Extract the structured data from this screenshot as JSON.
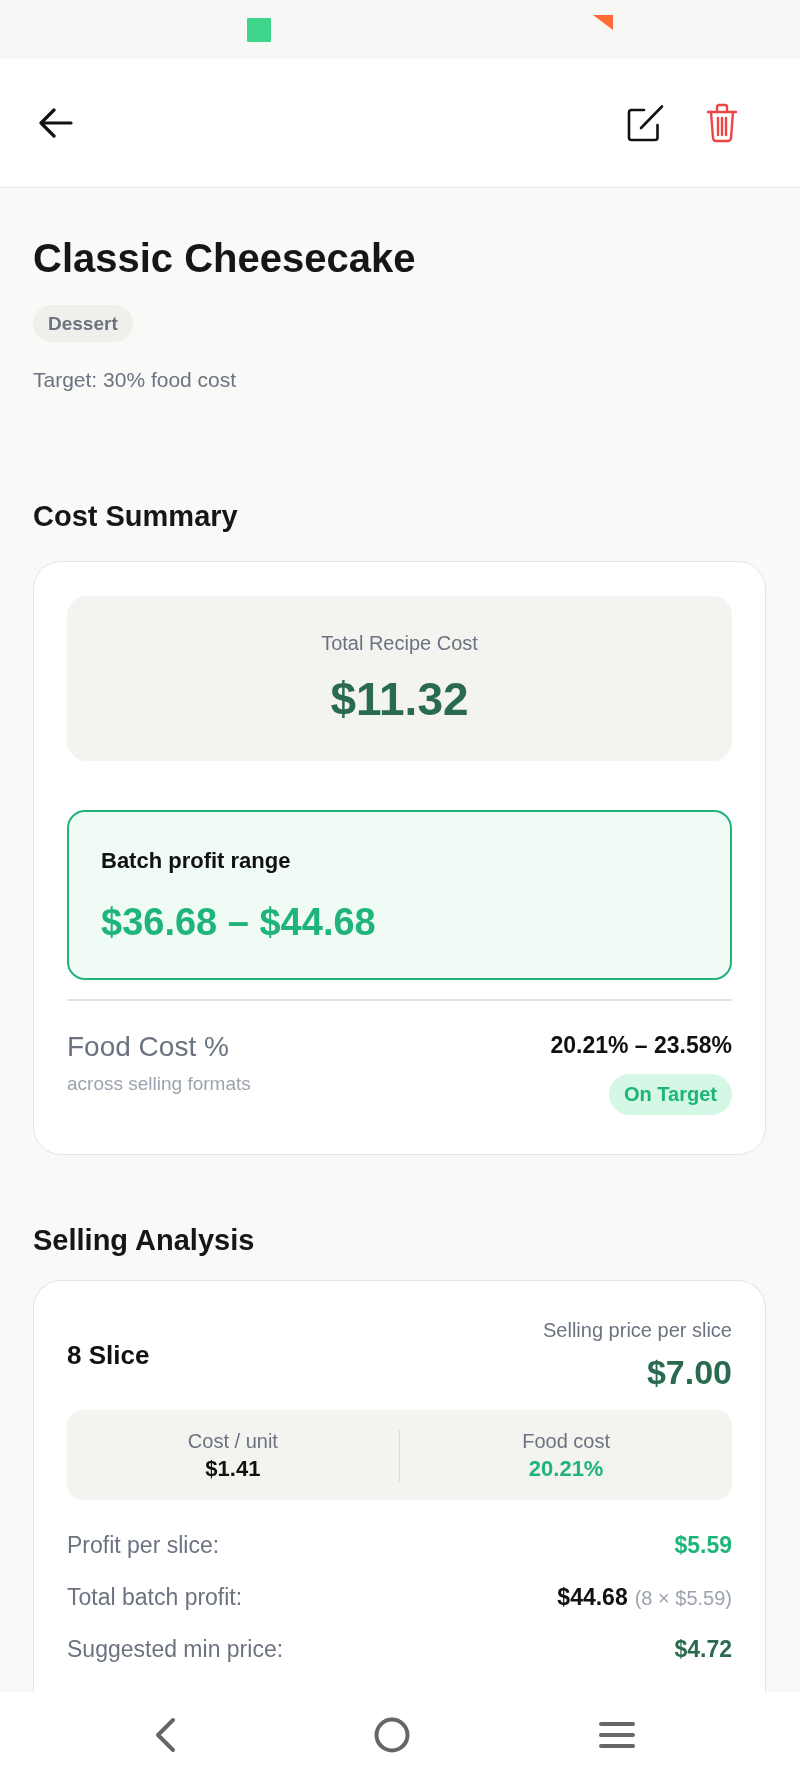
{
  "recipe": {
    "title": "Classic Cheesecake",
    "category": "Dessert",
    "target": "Target: 30% food cost"
  },
  "cost_summary": {
    "heading": "Cost Summary",
    "total": {
      "label": "Total Recipe Cost",
      "value": "$11.32"
    },
    "profit_range": {
      "label": "Batch profit range",
      "value": "$36.68 – $44.68"
    },
    "food_cost": {
      "label": "Food Cost %",
      "sublabel": "across selling formats",
      "value": "20.21% – 23.58%",
      "status": "On Target",
      "on_target": true
    }
  },
  "selling_analysis": {
    "heading": "Selling Analysis",
    "formats": [
      {
        "name": "8 Slice",
        "price_label": "Selling price per slice",
        "price": "$7.00",
        "stats": [
          {
            "label": "Cost / unit",
            "value": "$1.41",
            "kind": "neutral"
          },
          {
            "label": "Food cost",
            "value": "20.21%",
            "kind": "good"
          }
        ],
        "rows": [
          {
            "label": "Profit per slice:",
            "value": "$5.59",
            "kind": "positive"
          },
          {
            "label": "Total batch profit:",
            "value": "$44.68",
            "note": "(8 × $5.59)",
            "kind": "plain"
          },
          {
            "label": "Suggested min price:",
            "value": "$4.72",
            "kind": "price"
          }
        ]
      }
    ]
  }
}
